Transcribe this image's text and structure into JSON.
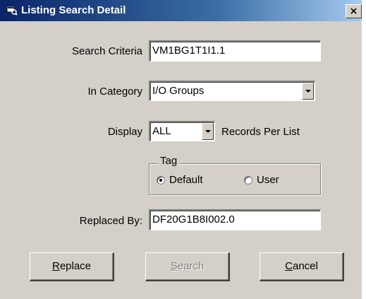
{
  "window": {
    "title": "Listing Search Detail",
    "close_glyph": "×"
  },
  "search_criteria": {
    "label": "Search Criteria",
    "value": "VM1BG1T1I1.1"
  },
  "in_category": {
    "label": "In Category",
    "value": "I/O Groups"
  },
  "display": {
    "label": "Display",
    "value": "ALL",
    "suffix": "Records Per List"
  },
  "tag": {
    "label": "Tag",
    "options": [
      {
        "label": "Default",
        "selected": true
      },
      {
        "label": "User",
        "selected": false
      }
    ]
  },
  "replaced_by": {
    "label": "Replaced By:",
    "value": "DF20G1B8I002.0"
  },
  "buttons": {
    "replace": {
      "mnemonic": "R",
      "rest": "eplace",
      "enabled": true
    },
    "search": {
      "mnemonic": "S",
      "rest": "earch",
      "enabled": false
    },
    "cancel": {
      "mnemonic": "C",
      "rest": "ancel",
      "enabled": true
    }
  }
}
